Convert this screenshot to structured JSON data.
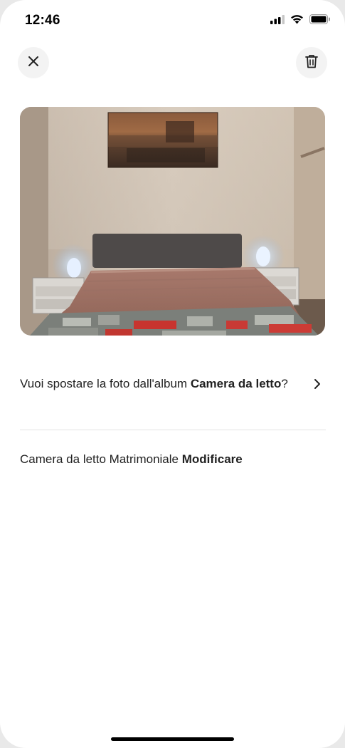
{
  "status_bar": {
    "time": "12:46",
    "icons": [
      "cellular-signal-icon",
      "wifi-icon",
      "battery-icon"
    ]
  },
  "toolbar": {
    "close_icon": "close-icon",
    "delete_icon": "trash-icon"
  },
  "photo": {
    "subject": "bedroom"
  },
  "move_prompt": {
    "text_prefix": "Vuoi spostare la foto dall'album ",
    "album_name": "Camera da letto",
    "text_suffix": "?",
    "chevron_icon": "chevron-right-icon"
  },
  "caption": {
    "text": "Camera da letto Matrimoniale ",
    "edit_label": "Modificare"
  },
  "colors": {
    "background": "#ffffff",
    "text": "#222222",
    "button_bg": "#f3f3f3",
    "divider": "#e2e2e2"
  }
}
